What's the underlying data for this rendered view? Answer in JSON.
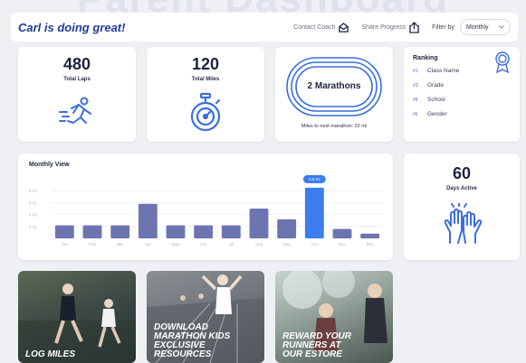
{
  "background_title": "Parent Dashboard",
  "header": {
    "greeting": "Carl is doing great!",
    "contact_coach": "Contact Coach",
    "share_progress": "Share Progress",
    "filter_label": "Filter by",
    "filter_value": "Monthly"
  },
  "stats": {
    "laps": {
      "value": "480",
      "label": "Total Laps",
      "icon": "runner-icon"
    },
    "miles": {
      "value": "120",
      "label": "Total Miles",
      "icon": "stopwatch-icon"
    },
    "marathons": {
      "value": "2 Marathons",
      "label": "Miles to next marathon: 22 mi",
      "icon": "track-icon"
    },
    "days_active": {
      "value": "60",
      "label": "Days Active",
      "icon": "high-five-icon"
    }
  },
  "ranking": {
    "title": "Ranking",
    "items": [
      {
        "rank": "#1",
        "label": "Class Name"
      },
      {
        "rank": "#3",
        "label": "Grade"
      },
      {
        "rank": "#8",
        "label": "School"
      },
      {
        "rank": "#6",
        "label": "Gender"
      }
    ],
    "icon": "award-ribbon-icon"
  },
  "chart_data": {
    "type": "bar",
    "title": "Monthly View",
    "categories": [
      "Jan",
      "Feb",
      "Mar",
      "Apr",
      "May",
      "Jun",
      "Jul",
      "Aug",
      "Sep",
      "Oct",
      "Nov",
      "Dec"
    ],
    "values": [
      2.2,
      2.2,
      2.2,
      5.8,
      2.2,
      2.2,
      2.2,
      5.0,
      3.2,
      8.5,
      1.6,
      0.8
    ],
    "y_ticks": [
      "8 mi",
      "6 mi",
      "4 mi",
      "2 mi"
    ],
    "highlight_index": 9,
    "highlight_label": "8.5 mi",
    "ylim": [
      0,
      10
    ],
    "bar_color": "#6d75b0",
    "highlight_color": "#3b7df0"
  },
  "promos": [
    {
      "text_lines": [
        "LOG MILES"
      ]
    },
    {
      "text_lines": [
        "DOWNLOAD",
        "MARATHON KIDS",
        "EXCLUSIVE",
        "RESOURCES"
      ]
    },
    {
      "text_lines": [
        "REWARD YOUR",
        "RUNNERS AT",
        "OUR ESTORE"
      ]
    }
  ],
  "colors": {
    "accent": "#3b6ee0",
    "navy": "#1f3c9a"
  }
}
